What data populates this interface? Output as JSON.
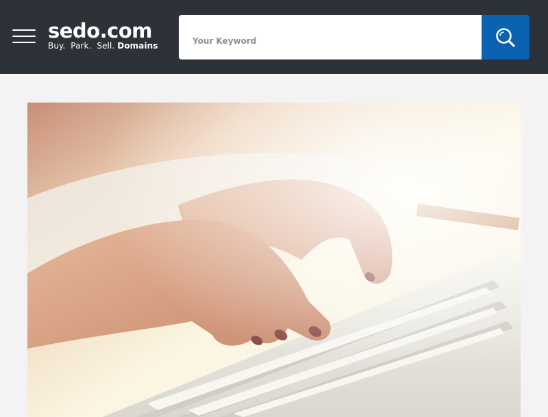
{
  "header": {
    "logo": {
      "name": "sedo.com",
      "tagline_plain": "Buy.  Park.  Sell.",
      "tagline_bold": "Domains"
    },
    "menu_icon": "hamburger-menu-icon",
    "search": {
      "placeholder": "Your Keyword",
      "value": "",
      "button_icon": "search-icon"
    }
  },
  "hero": {
    "image_subject": "hands typing on a laptop keyboard"
  },
  "colors": {
    "header_bg": "#2d3138",
    "search_button": "#0b62b0",
    "page_bg": "#f3f3f3"
  }
}
